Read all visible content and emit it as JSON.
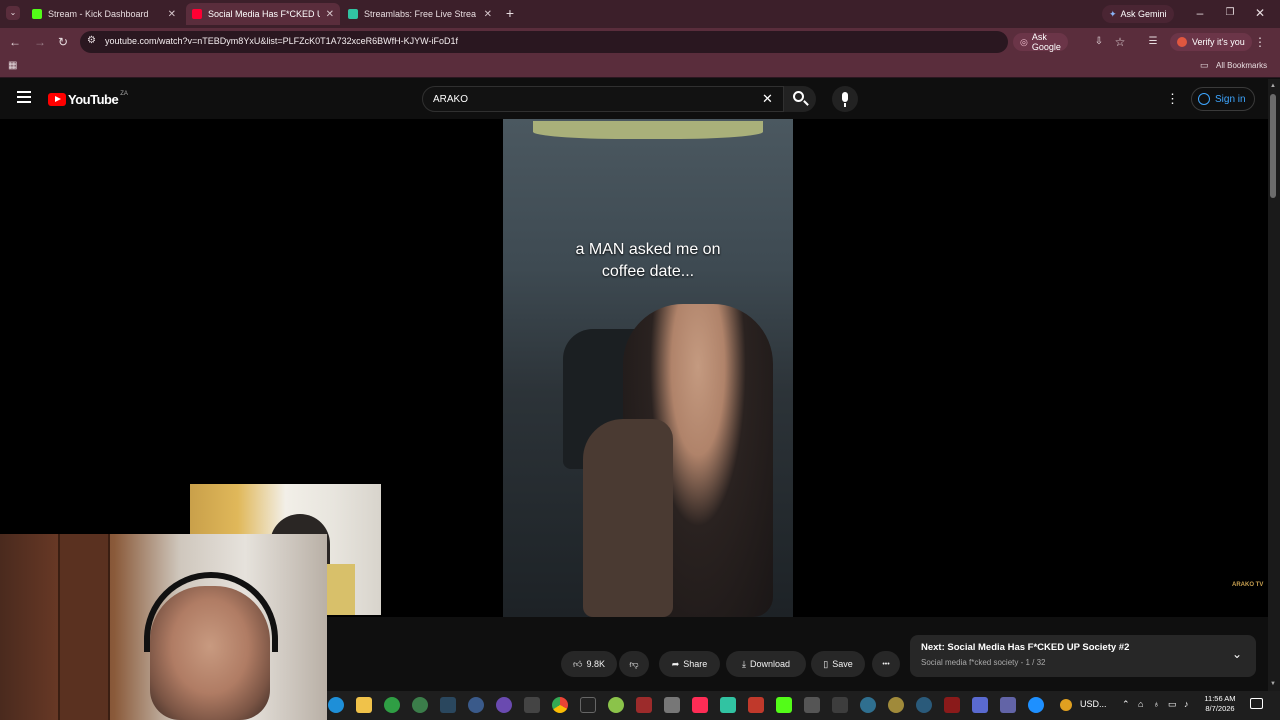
{
  "browser": {
    "tabs": [
      {
        "title": "Stream - Kick Dashboard",
        "color": "#53fc18"
      },
      {
        "title": "Social Media Has F*CKED UP Society",
        "color": "#ff0033"
      },
      {
        "title": "Streamlabs: Free Live Streaming",
        "color": "#31c3a2"
      }
    ],
    "new_tab": "+",
    "ask_gemini": "Ask Gemini",
    "url": "youtube.com/watch?v=nTEBDym8YxU&list=PLFZcK0T1A732xceR6BWfH-KJYW-iFoD1f",
    "ask_google": "Ask Google",
    "profile": "Verify it's you",
    "all_bookmarks": "All Bookmarks",
    "accent": "#5a2d3c"
  },
  "youtube": {
    "logo_text": "YouTube",
    "region": "ZA",
    "search_value": "ARAKO",
    "sign_in": "Sign in",
    "overlay_text_line1": "a MAN asked me on",
    "overlay_text_line2": "coffee date...",
    "watermark": "ARAKO TV",
    "actions": {
      "likes": "9.8K",
      "share": "Share",
      "download": "Download",
      "save": "Save",
      "more": "•••"
    },
    "next": {
      "title": "Next: Social Media Has F*CKED UP Society #2",
      "subtitle": "Social media f*cked society - 1 / 32"
    }
  },
  "taskbar": {
    "tray_text": "USD...",
    "time": "11:56 AM",
    "date": "8/7/2026"
  }
}
